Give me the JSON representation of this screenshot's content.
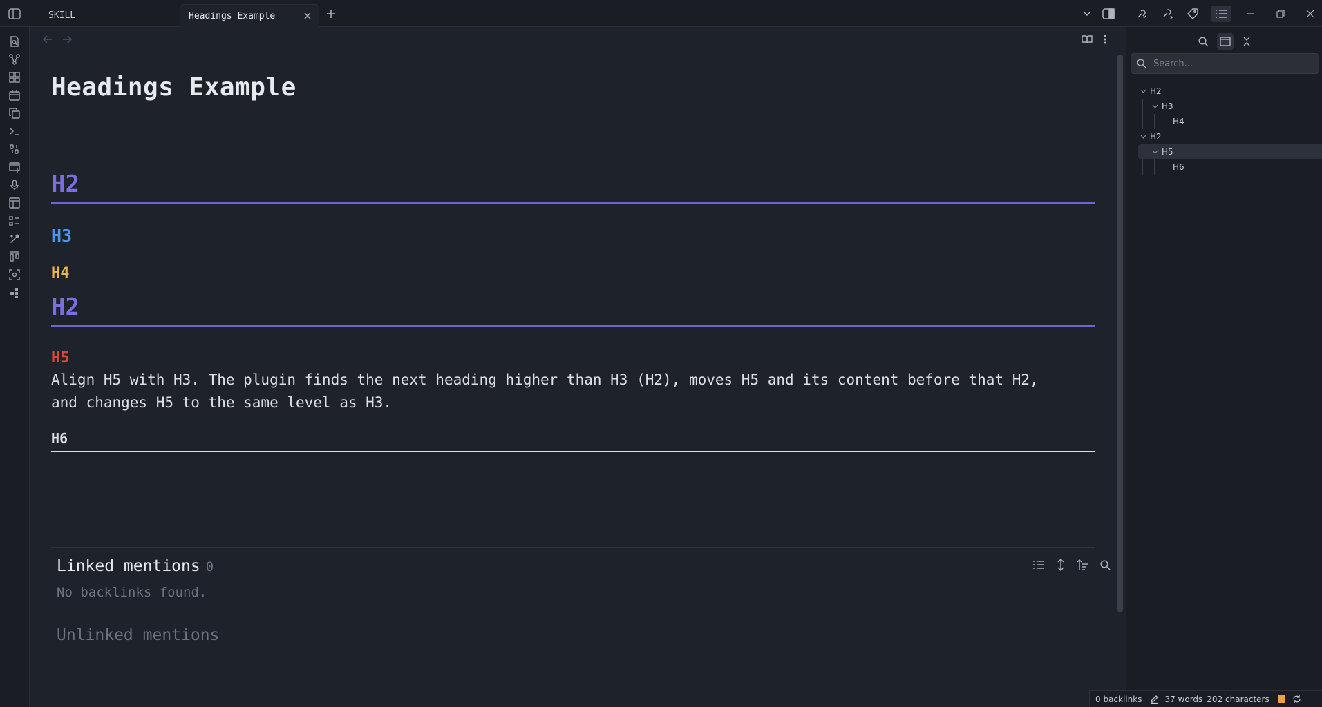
{
  "tabs": [
    {
      "label": "SKILL",
      "active": false
    },
    {
      "label": "Headings Example",
      "active": true
    }
  ],
  "icons": {
    "sidebar_toggle": "sidebar-toggle-icon",
    "new_tab": "plus-icon",
    "close": "close-icon"
  },
  "editor": {
    "title": "Headings Example",
    "headings": [
      {
        "level": "H2",
        "text": "H2"
      },
      {
        "level": "H3",
        "text": "H3"
      },
      {
        "level": "H4",
        "text": "H4"
      },
      {
        "level": "H2",
        "text": "H2"
      },
      {
        "level": "H5",
        "text": "H5"
      },
      {
        "level": "H6",
        "text": "H6"
      }
    ],
    "paragraph": "Align H5 with H3. The plugin finds the next heading higher than H3 (H2), moves H5 and its content before that H2, and changes H5 to the same level as H3."
  },
  "backlinks": {
    "linked_title": "Linked mentions",
    "linked_count": "0",
    "empty_text": "No backlinks found.",
    "unlinked_title": "Unlinked mentions"
  },
  "outline": {
    "search_placeholder": "Search...",
    "items": [
      {
        "label": "H2",
        "depth": 0,
        "collapsible": true
      },
      {
        "label": "H3",
        "depth": 1,
        "collapsible": true
      },
      {
        "label": "H4",
        "depth": 2,
        "collapsible": false
      },
      {
        "label": "H2",
        "depth": 0,
        "collapsible": true
      },
      {
        "label": "H5",
        "depth": 1,
        "collapsible": true,
        "highlighted": true
      },
      {
        "label": "H6",
        "depth": 2,
        "collapsible": false
      }
    ]
  },
  "status": {
    "backlinks": "0 backlinks",
    "words": "37 words",
    "characters": "202 characters"
  },
  "colors": {
    "h2": "#7b6fe0",
    "h3": "#4b95f0",
    "h4": "#f0b44c",
    "h5": "#d8473d",
    "sync": "#f0a33c"
  }
}
